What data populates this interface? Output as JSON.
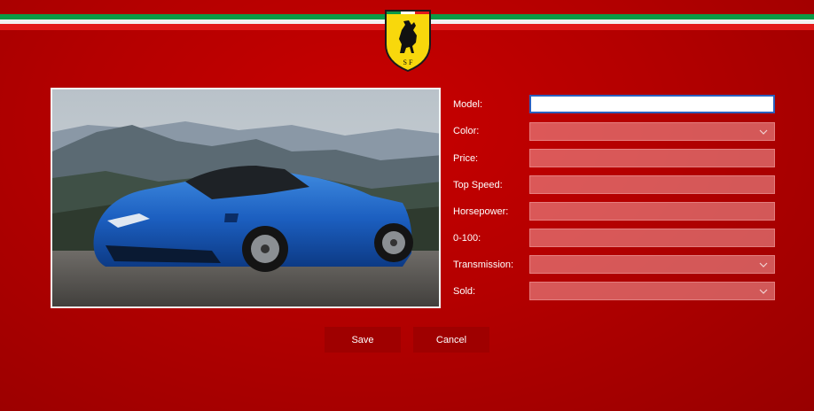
{
  "form": {
    "fields": [
      {
        "label": "Model:",
        "value": ""
      },
      {
        "label": "Color:",
        "value": ""
      },
      {
        "label": "Price:",
        "value": ""
      },
      {
        "label": "Top Speed:",
        "value": ""
      },
      {
        "label": "Horsepower:",
        "value": ""
      },
      {
        "label": "0-100:",
        "value": ""
      },
      {
        "label": "Transmission:",
        "value": ""
      },
      {
        "label": "Sold:",
        "value": ""
      }
    ]
  },
  "buttons": {
    "save_label": "Save",
    "cancel_label": "Cancel"
  },
  "logo": {
    "text": "S F"
  },
  "colors": {
    "accent_green": "#0b9a46",
    "accent_white": "#f2f2f2",
    "accent_red": "#e21b1b",
    "background": "#b40000",
    "button": "#9f0000",
    "logo_yellow": "#f8d80c",
    "focus_border": "#2b5fbd"
  }
}
